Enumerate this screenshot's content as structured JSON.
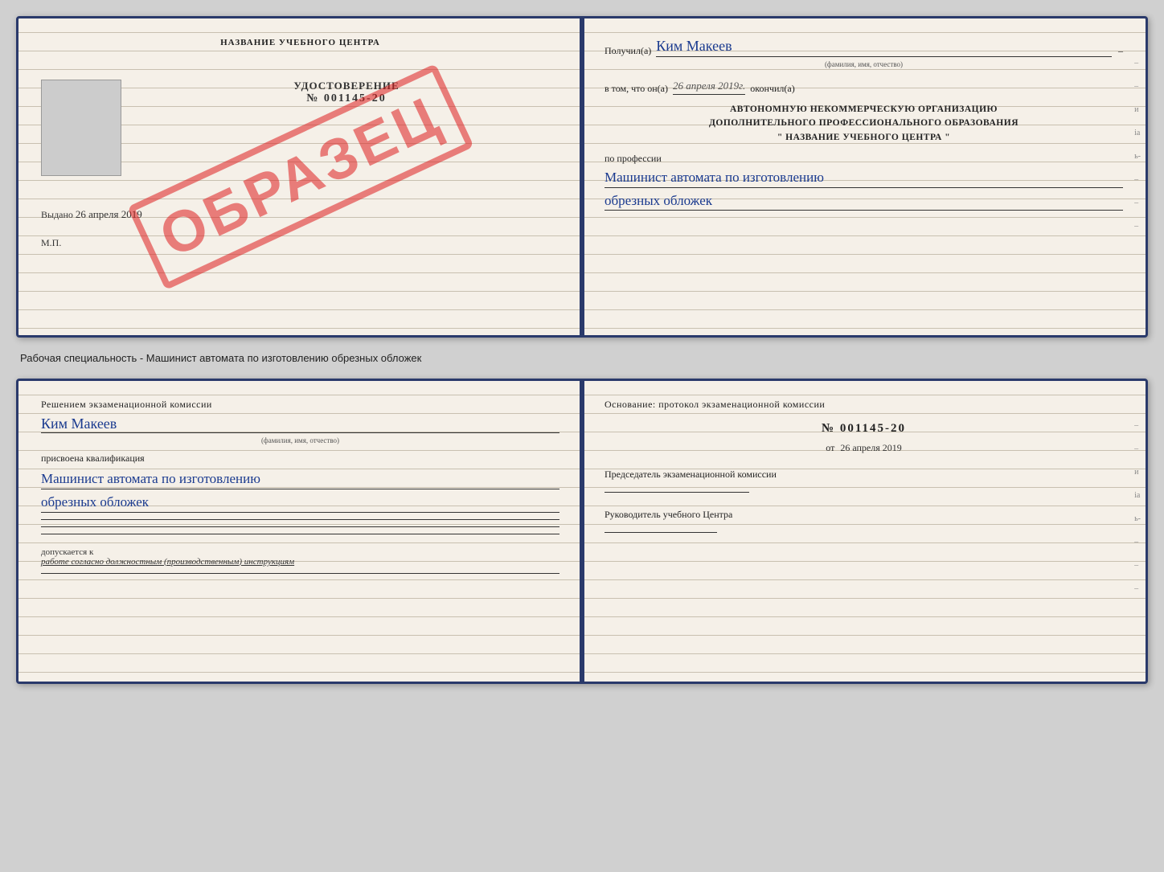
{
  "cert1": {
    "left": {
      "title": "НАЗВАНИЕ УЧЕБНОГО ЦЕНТРА",
      "stamp": "ОБРАЗЕЦ",
      "udostoverenie_label": "УДОСТОВЕРЕНИЕ",
      "number": "№ 001145-20",
      "vydano_label": "Выдано",
      "vydano_date": "26 апреля 2019",
      "mp_label": "М.П."
    },
    "right": {
      "poluchil_label": "Получил(а)",
      "recipient_name": "Ким Макеев",
      "fio_hint": "(фамилия, имя, отчество)",
      "vtom_label": "в том, что он(а)",
      "date_value": "26 апреля 2019г.",
      "okonchil_label": "окончил(а)",
      "org_line1": "АВТОНОМНУЮ НЕКОММЕРЧЕСКУЮ ОРГАНИЗАЦИЮ",
      "org_line2": "ДОПОЛНИТЕЛЬНОГО ПРОФЕССИОНАЛЬНОГО ОБРАЗОВАНИЯ",
      "org_line3": "\"   НАЗВАНИЕ УЧЕБНОГО ЦЕНТРА   \"",
      "po_professii": "по профессии",
      "profession1": "Машинист автомата по изготовлению",
      "profession2": "обрезных обложек"
    }
  },
  "caption": "Рабочая специальность - Машинист автомата по изготовлению обрезных обложек",
  "cert2": {
    "left": {
      "resheniem_text": "Решением экзаменационной комиссии",
      "name": "Ким Макеев",
      "fio_hint": "(фамилия, имя, отчество)",
      "prisvoena": "присвоена квалификация",
      "kvali1": "Машинист автомата по изготовлению",
      "kvali2": "обрезных обложек",
      "dopuskaetsya_prefix": "допускается к",
      "dopuskaetsya_italic": "работе согласно должностным (производственным) инструкциям"
    },
    "right": {
      "osnovanie_text": "Основание: протокол экзаменационной комиссии",
      "protocol_number": "№  001145-20",
      "ot_label": "от",
      "ot_date": "26 апреля 2019",
      "predsedatel_label": "Председатель экзаменационной комиссии",
      "rukovoditel_label": "Руководитель учебного Центра"
    }
  }
}
